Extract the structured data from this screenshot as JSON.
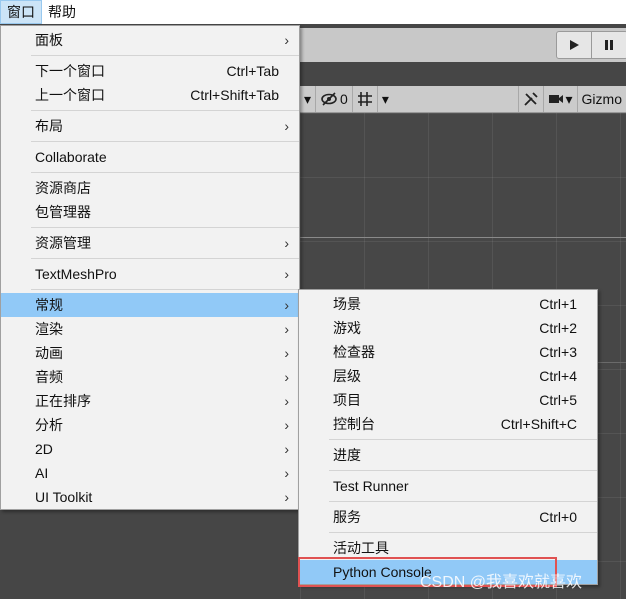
{
  "menubar": {
    "items": [
      {
        "label": "窗口",
        "active": true
      },
      {
        "label": "帮助",
        "active": false
      }
    ]
  },
  "editor": {
    "scene_toolbar": {
      "hidden_count": "0",
      "gizmos_label": "Gizmo"
    }
  },
  "main_menu": {
    "groups": [
      [
        {
          "label": "面板",
          "shortcut": "",
          "submenu": true
        }
      ],
      [
        {
          "label": "下一个窗口",
          "shortcut": "Ctrl+Tab",
          "submenu": false
        },
        {
          "label": "上一个窗口",
          "shortcut": "Ctrl+Shift+Tab",
          "submenu": false
        }
      ],
      [
        {
          "label": "布局",
          "shortcut": "",
          "submenu": true
        }
      ],
      [
        {
          "label": "Collaborate",
          "shortcut": "",
          "submenu": false
        }
      ],
      [
        {
          "label": "资源商店",
          "shortcut": "",
          "submenu": false
        },
        {
          "label": "包管理器",
          "shortcut": "",
          "submenu": false
        }
      ],
      [
        {
          "label": "资源管理",
          "shortcut": "",
          "submenu": true
        }
      ],
      [
        {
          "label": "TextMeshPro",
          "shortcut": "",
          "submenu": true
        }
      ],
      [
        {
          "label": "常规",
          "shortcut": "",
          "submenu": true,
          "highlight": true
        },
        {
          "label": "渲染",
          "shortcut": "",
          "submenu": true
        },
        {
          "label": "动画",
          "shortcut": "",
          "submenu": true
        },
        {
          "label": "音频",
          "shortcut": "",
          "submenu": true
        },
        {
          "label": "正在排序",
          "shortcut": "",
          "submenu": true
        },
        {
          "label": "分析",
          "shortcut": "",
          "submenu": true
        },
        {
          "label": "2D",
          "shortcut": "",
          "submenu": true
        },
        {
          "label": "AI",
          "shortcut": "",
          "submenu": true
        },
        {
          "label": "UI Toolkit",
          "shortcut": "",
          "submenu": true
        }
      ]
    ]
  },
  "sub_menu": {
    "groups": [
      [
        {
          "label": "场景",
          "shortcut": "Ctrl+1"
        },
        {
          "label": "游戏",
          "shortcut": "Ctrl+2"
        },
        {
          "label": "检查器",
          "shortcut": "Ctrl+3"
        },
        {
          "label": "层级",
          "shortcut": "Ctrl+4"
        },
        {
          "label": "项目",
          "shortcut": "Ctrl+5"
        },
        {
          "label": "控制台",
          "shortcut": "Ctrl+Shift+C"
        }
      ],
      [
        {
          "label": "进度",
          "shortcut": ""
        }
      ],
      [
        {
          "label": "Test Runner",
          "shortcut": ""
        }
      ],
      [
        {
          "label": "服务",
          "shortcut": "Ctrl+0"
        }
      ],
      [
        {
          "label": "活动工具",
          "shortcut": ""
        },
        {
          "label": "Python Console",
          "shortcut": "",
          "highlight": true
        }
      ]
    ]
  },
  "watermark": "CSDN @我喜欢就喜欢",
  "colors": {
    "menu_highlight": "#91c9f7",
    "annotation_box": "#e05252"
  }
}
